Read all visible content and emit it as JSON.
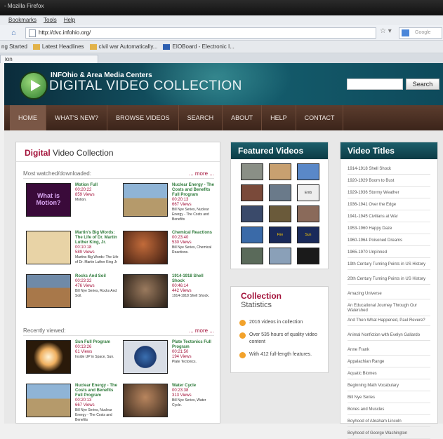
{
  "browser": {
    "window_title": "- Mozilla Firefox",
    "menu": [
      "Bookmarks",
      "Tools",
      "Help"
    ],
    "url": "http://dvc.infohio.org/",
    "search_placeholder": "Google",
    "bookmarks": [
      "ng Started",
      "Latest Headlines",
      "civil war Automatically...",
      "EIOBoard - Electronic I..."
    ],
    "tab_label": "ion"
  },
  "site": {
    "subtitle": "INFOhio & Area Media Centers",
    "title": "DIGITAL VIDEO COLLECTION",
    "search_button": "Search",
    "nav": [
      "HOME",
      "WHAT'S NEW?",
      "BROWSE VIDEOS",
      "SEARCH",
      "ABOUT",
      "HELP",
      "CONTACT"
    ]
  },
  "main_panel": {
    "heading_bold": "Digital",
    "heading_rest": " Video Collection",
    "most_watched_label": "Most watched/downloaded:",
    "recent_label": "Recently viewed:",
    "more": "... more ...",
    "most_watched": [
      {
        "title": "Motion Full",
        "duration": "00:20:22",
        "views": "859 Views",
        "series": "Motion.",
        "thumb_text": "What is Motion?"
      },
      {
        "title": "Nuclear Energy - The Costs and Benefits Full Program",
        "duration": "00:20:13",
        "views": "667 Views",
        "series": "Bill Nye Series, Nuclear Energy - The Costs and Benefits"
      },
      {
        "title": "Martin's Big Words: The Life of Dr. Martin Luther King, Jr.",
        "duration": "00:10:18",
        "views": "589 Views",
        "series": "Martins Big Words: The Life of Dr. Martin Luther King Jr"
      },
      {
        "title": "Chemical Reactions",
        "duration": "00:23:40",
        "views": "530 Views",
        "series": "Bill Nye Series, Chemical Reactions."
      },
      {
        "title": "Rocks And Soil",
        "duration": "00:23:32",
        "views": "476 Views",
        "series": "Bill Nye Series, Rocks And Soil."
      },
      {
        "title": "1914-1918 Shell Shock",
        "duration": "00:46:14",
        "views": "442 Views",
        "series": "1914-1918 Shell Shock."
      }
    ],
    "recent": [
      {
        "title": "Sun Full Program",
        "duration": "00:13:26",
        "views": "61 Views",
        "series": "Inside UP in Space, Sun."
      },
      {
        "title": "Plate Tectonics Full Program",
        "duration": "00:21:50",
        "views": "194 Views",
        "series": "Plate Tectonics."
      },
      {
        "title": "Nuclear Energy - The Costs and Benefits Full Program",
        "duration": "00:20:13",
        "views": "667 Views",
        "series": "Bill Nye Series, Nuclear Energy - The Costs and Benefits"
      },
      {
        "title": "Water Cycle",
        "duration": "00:23:38",
        "views": "313 Views",
        "series": "Bill Nye Series, Water Cycle."
      }
    ]
  },
  "featured": {
    "heading": "Featured Videos",
    "thumb_texts": [
      "Emb",
      "Fire",
      "Sun"
    ]
  },
  "stats": {
    "heading_a": "Collection",
    "heading_b": "Statistics",
    "items": [
      "2016 videos in collection",
      "Over 535 hours of quality video content",
      "With 412 full-length features."
    ]
  },
  "titles": {
    "heading": "Video Titles",
    "list": [
      "1914-1918 Shell Shock",
      "1920-1929 Boom to Bust",
      "1929-1936 Stormy Weather",
      "1936-1941 Over the Edge",
      "1941-1945 Civilians at War",
      "1953-1960 Happy Daze",
      "1960-1964 Poisoned Dreams",
      "1965-1970 Unpinned",
      "19th Century Turning Points in US History",
      "20th Century Turning Points in US History",
      "Amazing Universe",
      "An Educational Journey Through Our Watershed",
      "And Then What Happened, Paul Revere?",
      "Animal Nonfiction with Evelyn Gallardo",
      "Anne Frank",
      "Appalachian Range",
      "Aquatic Biomes",
      "Beginning Math Vocabulary",
      "Bill Nye Series",
      "Bones and Muscles",
      "Boyhood of Abraham Lincoln",
      "Boyhood of George Washington"
    ]
  },
  "colors": {
    "accent": "#a3123a",
    "title_green": "#2e7a3a",
    "header_teal": "#155f6f",
    "nav_brown": "#4b2f22"
  }
}
